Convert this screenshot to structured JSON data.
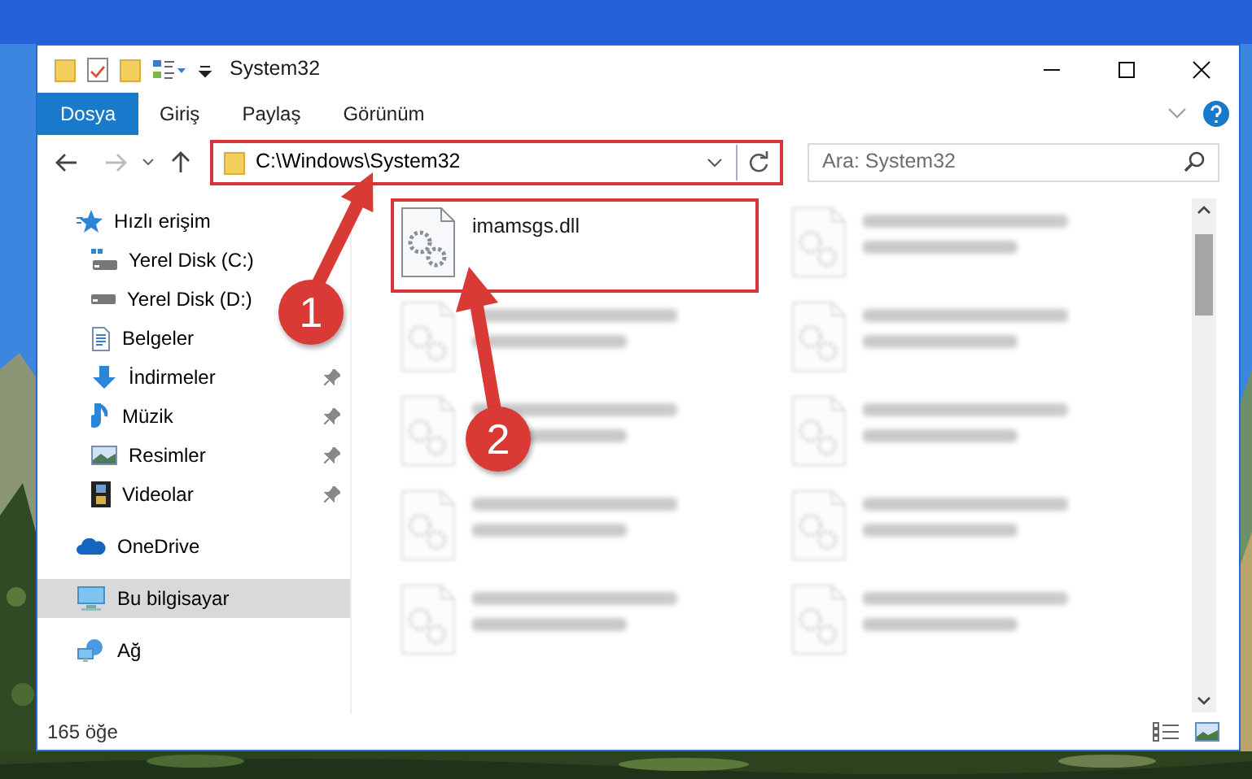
{
  "window": {
    "title": "System32"
  },
  "ribbon_tabs": [
    {
      "label": "Dosya",
      "selected": true
    },
    {
      "label": "Giriş",
      "selected": false
    },
    {
      "label": "Paylaş",
      "selected": false
    },
    {
      "label": "Görünüm",
      "selected": false
    }
  ],
  "address_bar": {
    "path": "C:\\Windows\\System32",
    "highlighted": true
  },
  "search": {
    "placeholder": "Ara: System32"
  },
  "sidebar": {
    "items": [
      {
        "label": "Hızlı erişim",
        "selected": false,
        "children": [
          {
            "label": "Yerel Disk (C:)",
            "pinned": false
          },
          {
            "label": "Yerel Disk (D:)",
            "pinned": false
          },
          {
            "label": "Belgeler",
            "pinned": false
          },
          {
            "label": "İndirmeler",
            "pinned": true
          },
          {
            "label": "Müzik",
            "pinned": true
          },
          {
            "label": "Resimler",
            "pinned": true
          },
          {
            "label": "Videolar",
            "pinned": true
          }
        ]
      },
      {
        "label": "OneDrive",
        "selected": false
      },
      {
        "label": "Bu bilgisayar",
        "selected": true
      },
      {
        "label": "Ağ",
        "selected": false
      }
    ]
  },
  "files": [
    {
      "name": "imamsgs.dll",
      "highlighted": true,
      "blurred": false
    },
    {
      "highlighted": false,
      "blurred": true
    },
    {
      "highlighted": false,
      "blurred": true
    },
    {
      "highlighted": false,
      "blurred": true
    },
    {
      "highlighted": false,
      "blurred": true
    },
    {
      "highlighted": false,
      "blurred": true
    },
    {
      "highlighted": false,
      "blurred": true
    },
    {
      "highlighted": false,
      "blurred": true
    },
    {
      "highlighted": false,
      "blurred": true
    },
    {
      "highlighted": false,
      "blurred": true
    }
  ],
  "status_bar": {
    "item_count": "165 öğe"
  },
  "callouts": [
    {
      "label": "1"
    },
    {
      "label": "2"
    }
  ]
}
